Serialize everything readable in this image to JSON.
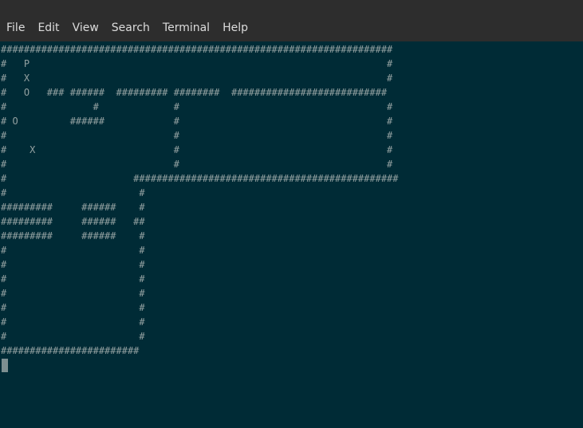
{
  "menubar": {
    "items": [
      {
        "id": "file",
        "label": "File"
      },
      {
        "id": "edit",
        "label": "Edit"
      },
      {
        "id": "view",
        "label": "View"
      },
      {
        "id": "search",
        "label": "Search"
      },
      {
        "id": "terminal",
        "label": "Terminal"
      },
      {
        "id": "help",
        "label": "Help"
      }
    ]
  },
  "terminal": {
    "lines": [
      "####################################################################",
      "#   P                                                              #",
      "#   X                                                              #",
      "#   O   ### ######  ######### ########  ###########################",
      "#               #             #                                    #",
      "# O         ######            #                                    #",
      "#                             #                                    #",
      "#    X                        #                                    #",
      "#                             #                                    #",
      "#                      ##############################################",
      "#                       #",
      "#########     ######    #",
      "#########     ######   ##",
      "#########     ######    #",
      "#                       #",
      "#                       #",
      "#                       #",
      "#                       #",
      "#                       #",
      "#                       #",
      "#                       #",
      "########################",
      ""
    ]
  }
}
